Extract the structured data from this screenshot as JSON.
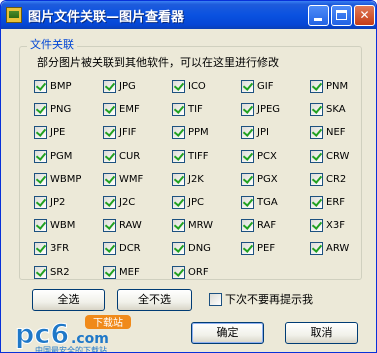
{
  "window": {
    "title": "图片文件关联—图片查看器"
  },
  "group": {
    "legend": "文件关联",
    "description": "部分图片被关联到其他软件，可以在这里进行修改"
  },
  "formats": [
    {
      "label": "BMP",
      "checked": true
    },
    {
      "label": "JPG",
      "checked": true
    },
    {
      "label": "ICO",
      "checked": true
    },
    {
      "label": "GIF",
      "checked": true
    },
    {
      "label": "PNM",
      "checked": true
    },
    {
      "label": "PNG",
      "checked": true
    },
    {
      "label": "EMF",
      "checked": true
    },
    {
      "label": "TIF",
      "checked": true
    },
    {
      "label": "JPEG",
      "checked": true
    },
    {
      "label": "SKA",
      "checked": true
    },
    {
      "label": "JPE",
      "checked": true
    },
    {
      "label": "JFIF",
      "checked": true
    },
    {
      "label": "PPM",
      "checked": true
    },
    {
      "label": "JPI",
      "checked": true
    },
    {
      "label": "NEF",
      "checked": true
    },
    {
      "label": "PGM",
      "checked": true
    },
    {
      "label": "CUR",
      "checked": true
    },
    {
      "label": "TIFF",
      "checked": true
    },
    {
      "label": "PCX",
      "checked": true
    },
    {
      "label": "CRW",
      "checked": true
    },
    {
      "label": "WBMP",
      "checked": true
    },
    {
      "label": "WMF",
      "checked": true
    },
    {
      "label": "J2K",
      "checked": true
    },
    {
      "label": "PGX",
      "checked": true
    },
    {
      "label": "CR2",
      "checked": true
    },
    {
      "label": "JP2",
      "checked": true
    },
    {
      "label": "J2C",
      "checked": true
    },
    {
      "label": "JPC",
      "checked": true
    },
    {
      "label": "TGA",
      "checked": true
    },
    {
      "label": "ERF",
      "checked": true
    },
    {
      "label": "WBM",
      "checked": true
    },
    {
      "label": "RAW",
      "checked": true
    },
    {
      "label": "MRW",
      "checked": true
    },
    {
      "label": "RAF",
      "checked": true
    },
    {
      "label": "X3F",
      "checked": true
    },
    {
      "label": "3FR",
      "checked": true
    },
    {
      "label": "DCR",
      "checked": true
    },
    {
      "label": "DNG",
      "checked": true
    },
    {
      "label": "PEF",
      "checked": true
    },
    {
      "label": "ARW",
      "checked": true
    },
    {
      "label": "SR2",
      "checked": true
    },
    {
      "label": "MEF",
      "checked": true
    },
    {
      "label": "ORF",
      "checked": true
    }
  ],
  "buttons": {
    "select_all": "全选",
    "select_none": "全不选",
    "ok": "确定",
    "cancel": "取消"
  },
  "no_prompt": {
    "label": "下次不要再提示我",
    "checked": false
  },
  "watermark": {
    "brand": "pc6",
    "suffix": ".com",
    "badge": "下载站",
    "slogan": "中国最安全的下载站"
  },
  "colors": {
    "titlebar": "#0a52e0",
    "face": "#ece9d8",
    "legend": "#0046d5",
    "check": "#21a121",
    "logo_blue": "#1f78c8",
    "logo_orange": "#f08a1a"
  }
}
